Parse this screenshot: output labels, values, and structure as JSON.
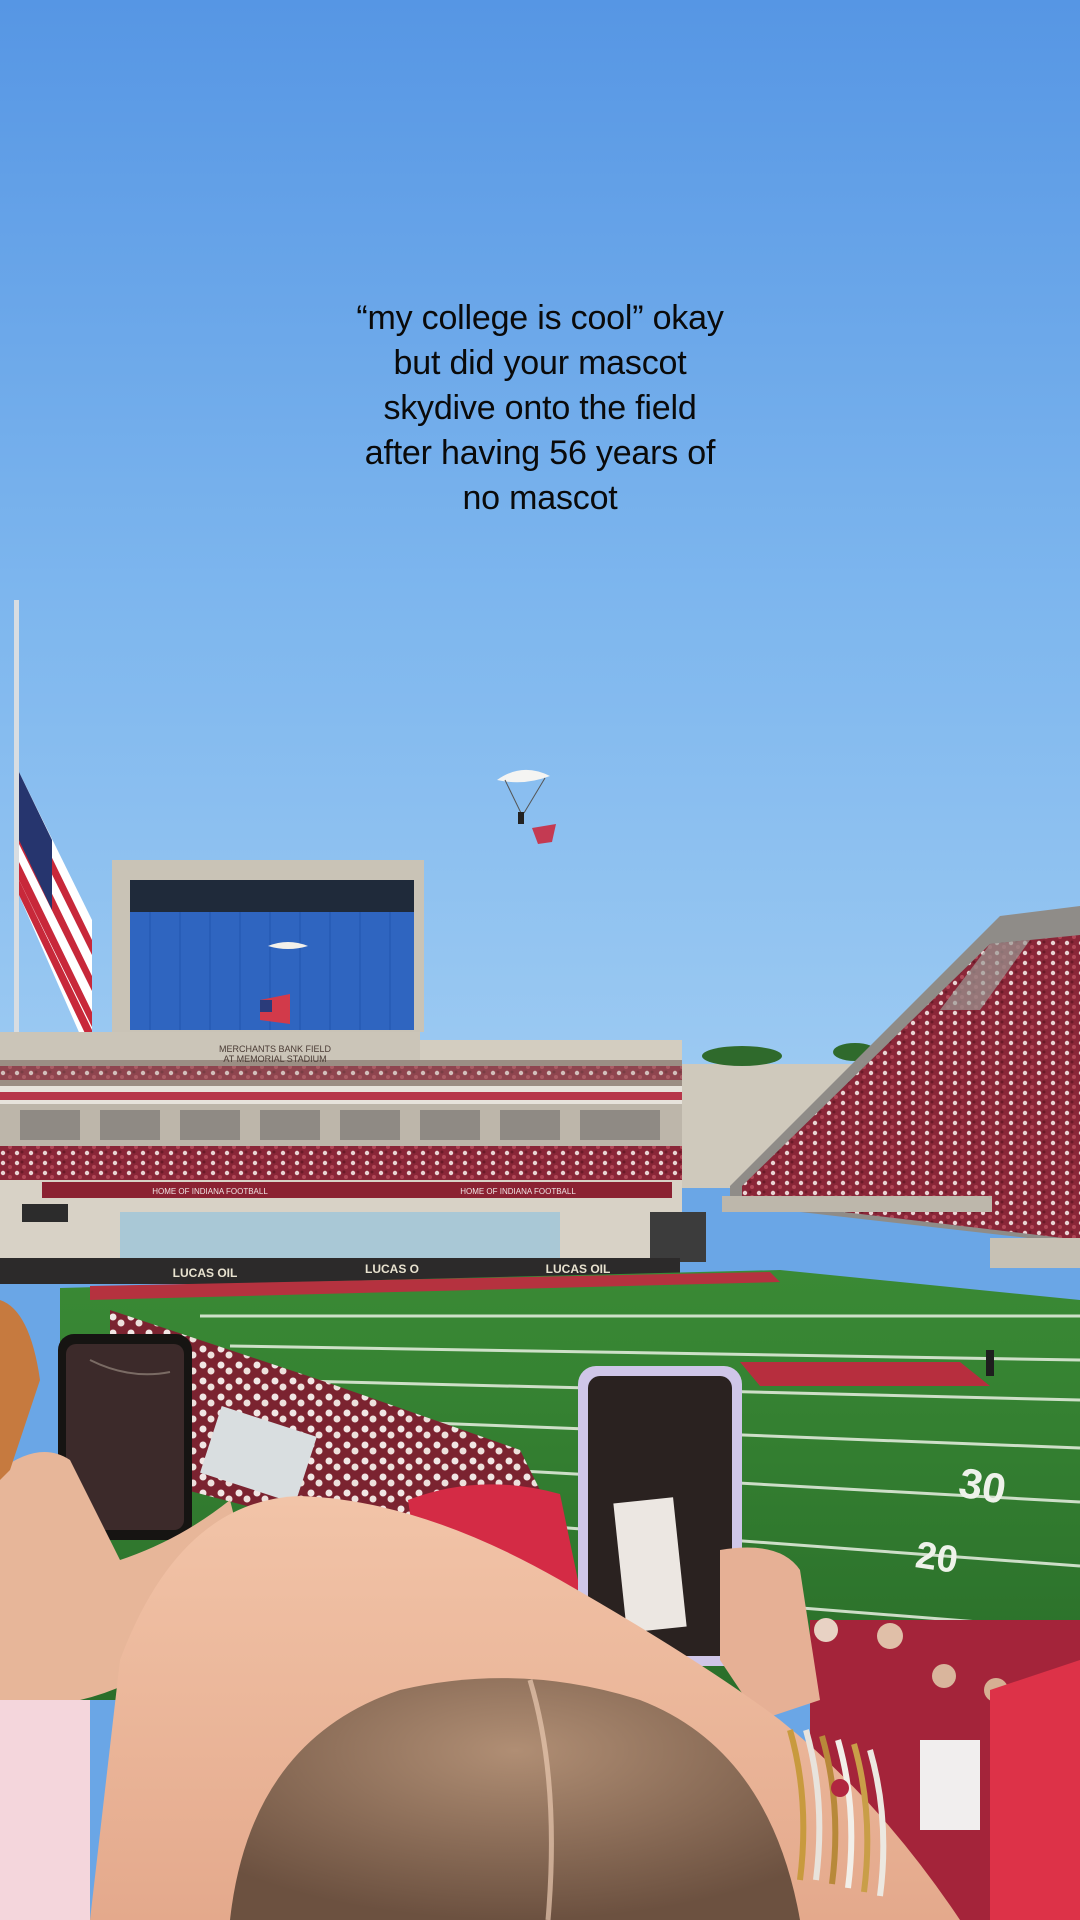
{
  "overlay_caption": {
    "line1": "“my college is cool” okay",
    "line2": "but did your mascot",
    "line3": "skydive onto the field",
    "line4": "after having 56 years of",
    "line5": "no mascot"
  },
  "stadium_signage": {
    "press_box_sign_line1": "MERCHANTS BANK FIELD",
    "press_box_sign_line2": "AT MEMORIAL STADIUM",
    "banner_left": "HOME OF INDIANA FOOTBALL",
    "banner_right": "HOME OF INDIANA FOOTBALL",
    "sponsor_left": "LUCAS OIL",
    "sponsor_middle": "LUCAS O",
    "sponsor_right": "LUCAS OIL"
  },
  "field_markings": {
    "yard_left": "30",
    "yard_right": "20"
  },
  "colors": {
    "sky_top": "#5c9de6",
    "sky_bottom": "#8fc3f2",
    "crimson": "#990000",
    "turf": "#2f7a2e",
    "scoreboard_blue": "#2f65c0"
  }
}
